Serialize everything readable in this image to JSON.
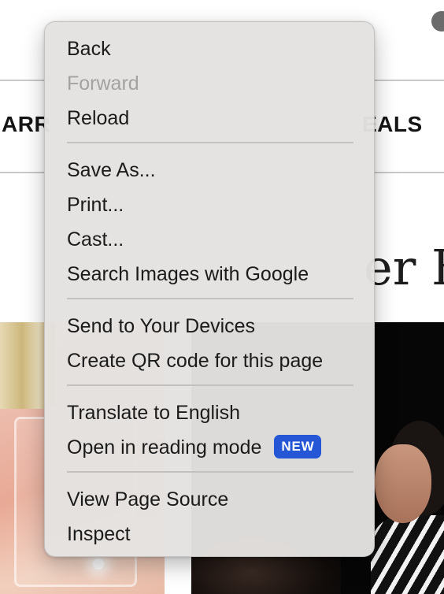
{
  "background_page": {
    "nav_left_fragment": "ARR",
    "nav_right_fragment": "EALS",
    "heading_fragment": "er B"
  },
  "context_menu": {
    "items": [
      {
        "label": "Back",
        "enabled": true
      },
      {
        "label": "Forward",
        "enabled": false
      },
      {
        "label": "Reload",
        "enabled": true
      },
      {
        "label": "Save As...",
        "enabled": true
      },
      {
        "label": "Print...",
        "enabled": true
      },
      {
        "label": "Cast...",
        "enabled": true
      },
      {
        "label": "Search Images with Google",
        "enabled": true
      },
      {
        "label": "Send to Your Devices",
        "enabled": true
      },
      {
        "label": "Create QR code for this page",
        "enabled": true
      },
      {
        "label": "Translate to English",
        "enabled": true
      },
      {
        "label": "Open in reading mode",
        "enabled": true,
        "badge": "NEW"
      },
      {
        "label": "View Page Source",
        "enabled": true
      },
      {
        "label": "Inspect",
        "enabled": true
      }
    ]
  },
  "colors": {
    "menu_background": "#e4e2e0",
    "disabled_text": "#a2a2a2",
    "badge_background": "#2456d6"
  }
}
